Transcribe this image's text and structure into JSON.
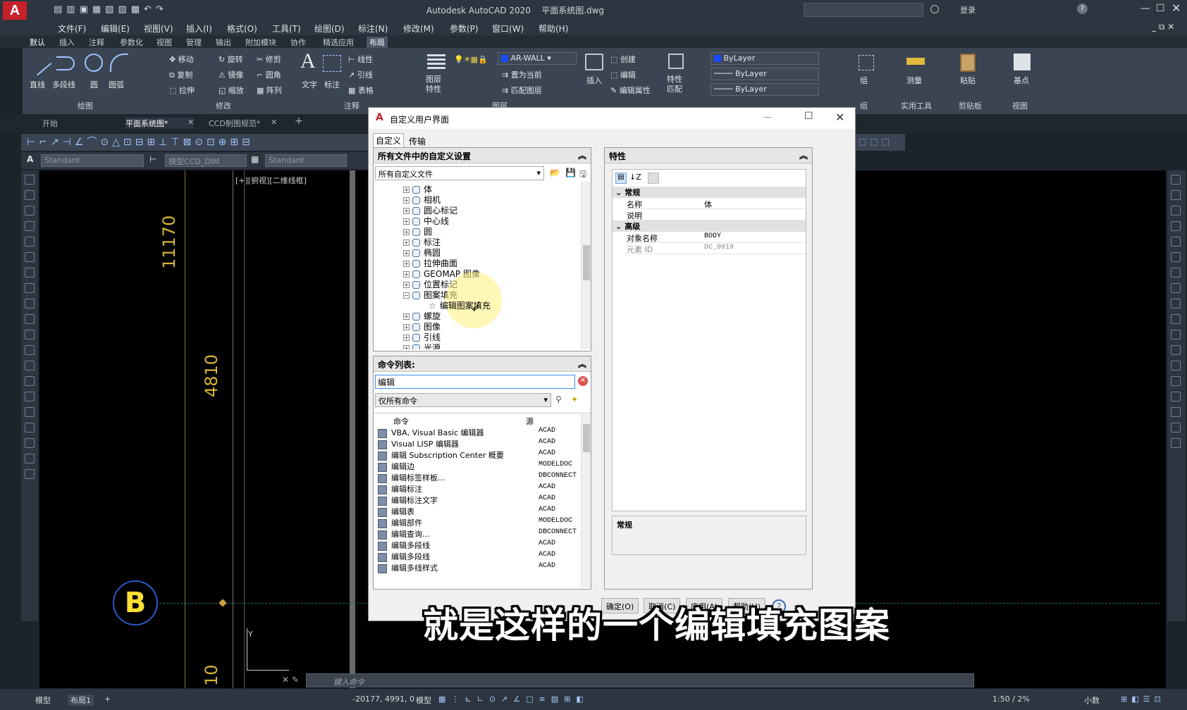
{
  "app": {
    "title": "Autodesk AutoCAD 2020",
    "file": "平面系统图.dwg",
    "login": "登录",
    "menu": [
      "文件(F)",
      "编辑(E)",
      "视图(V)",
      "插入(I)",
      "格式(O)",
      "工具(T)",
      "绘图(D)",
      "标注(N)",
      "修改(M)",
      "参数(P)",
      "窗口(W)",
      "帮助(H)"
    ],
    "ribbon_tabs": [
      "默认",
      "插入",
      "注释",
      "参数化",
      "视图",
      "管理",
      "输出",
      "附加模块",
      "协作",
      "精选应用",
      "布局"
    ],
    "active_ribbon_tab": "布局"
  },
  "ribbon": {
    "draw": {
      "title": "绘图",
      "items": [
        "直线",
        "多段线",
        "圆",
        "圆弧"
      ]
    },
    "modify": {
      "title": "修改",
      "items": [
        "移动",
        "旋转",
        "修剪",
        "复制",
        "镜像",
        "圆角",
        "拉伸",
        "缩放",
        "阵列"
      ]
    },
    "annotation": {
      "title": "注释",
      "items": [
        "文字",
        "标注",
        "线性",
        "引线",
        "表格"
      ]
    },
    "layers": {
      "title": "图层",
      "layer_name": "AR-WALL",
      "items": [
        "图层特性",
        "置为当前",
        "匹配图层"
      ]
    },
    "block": {
      "title": "块",
      "items": [
        "插入",
        "创建",
        "编辑",
        "编辑属性"
      ]
    },
    "properties": {
      "title": "特性",
      "items": [
        "特性匹配",
        "ByLayer",
        "ByLayer",
        "ByLayer"
      ]
    },
    "groups": {
      "title": "组",
      "items": [
        "组"
      ]
    },
    "utilities": {
      "title": "实用工具",
      "items": [
        "测量"
      ]
    },
    "clipboard": {
      "title": "剪贴板",
      "items": [
        "粘贴"
      ]
    },
    "view": {
      "title": "视图",
      "items": [
        "基点"
      ]
    }
  },
  "doc_tabs": [
    "开始",
    "平面系统图*",
    "CCD制图规范*"
  ],
  "styles": {
    "text": "Standard",
    "dim": "模型CCD_DIM",
    "table": "Standard"
  },
  "viewport_label": "[+][俯视][二维线框]",
  "drawing": {
    "dim1": "11170",
    "dim2": "4810",
    "dim3": "10",
    "grid_label": "B"
  },
  "dialog": {
    "title": "自定义用户界面",
    "tabs": [
      "自定义",
      "传输"
    ],
    "left_header": "所有文件中的自定义设置",
    "filter_combo": "所有自定义文件",
    "tree": [
      "体",
      "相机",
      "圆心标记",
      "中心线",
      "圆",
      "标注",
      "椭圆",
      "拉伸曲面",
      "GEOMAP 图像",
      "位置标记",
      "图案填充",
      "编辑图案填充",
      "螺旋",
      "图像",
      "引线",
      "光源",
      "直线"
    ],
    "cmd_header": "命令列表:",
    "search_value": "编辑",
    "cmd_filter": "仅所有命令",
    "cmd_columns": [
      "命令",
      "源"
    ],
    "commands": [
      {
        "name": "VBA, Visual Basic 编辑器",
        "src": "ACAD"
      },
      {
        "name": "Visual LISP 编辑器",
        "src": "ACAD"
      },
      {
        "name": "编辑 Subscription Center 概要",
        "src": "ACAD"
      },
      {
        "name": "编辑边",
        "src": "MODELDOC"
      },
      {
        "name": "编辑标签样板...",
        "src": "DBCONNECT"
      },
      {
        "name": "编辑标注",
        "src": "ACAD"
      },
      {
        "name": "编辑标注文字",
        "src": "ACAD"
      },
      {
        "name": "编辑表",
        "src": "ACAD"
      },
      {
        "name": "编辑部件",
        "src": "MODELDOC"
      },
      {
        "name": "编辑查询...",
        "src": "DBCONNECT"
      },
      {
        "name": "编辑多段线",
        "src": "ACAD"
      },
      {
        "name": "编辑多段线",
        "src": "ACAD"
      },
      {
        "name": "编辑多线样式",
        "src": "ACAD"
      }
    ],
    "props_header": "特性",
    "props": {
      "cat_general": "常规",
      "name_key": "名称",
      "name_val": "体",
      "desc_key": "说明",
      "desc_val": "",
      "cat_advanced": "高级",
      "obj_key": "对象名称",
      "obj_val": "BODY",
      "elem_key": "元素 ID",
      "elem_val": "DC_0019"
    },
    "desc_title": "常规",
    "buttons": [
      "确定(O)",
      "取消(C)",
      "应用(A)",
      "帮助(H)"
    ]
  },
  "subtitle": "就是这样的一个编辑填充图案",
  "command_prompt": "键入命令",
  "layout_tabs": [
    "模型",
    "布局1"
  ],
  "status": {
    "coords": "-20177, 4991, 0",
    "mode": "模型",
    "scale": "1:50 / 2%",
    "units": "小数"
  }
}
